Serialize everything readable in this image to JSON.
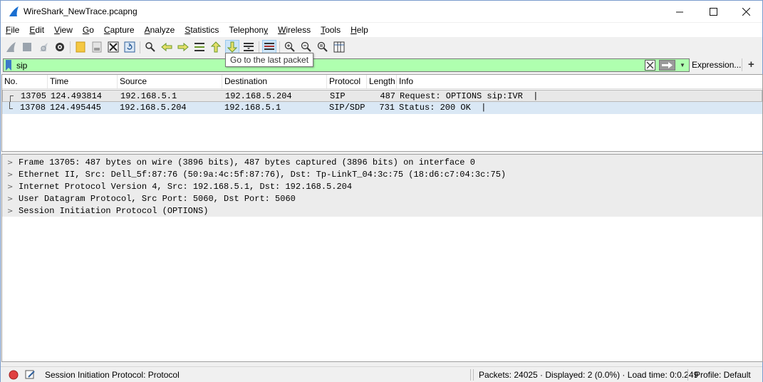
{
  "window": {
    "title": "WireShark_NewTrace.pcapng"
  },
  "menu": [
    "File",
    "Edit",
    "View",
    "Go",
    "Capture",
    "Analyze",
    "Statistics",
    "Telephony",
    "Wireless",
    "Tools",
    "Help"
  ],
  "menu_underline": [
    "F",
    "E",
    "V",
    "G",
    "C",
    "A",
    "S",
    "y",
    "W",
    "T",
    "H"
  ],
  "tooltip": "Go to the last packet",
  "filter": {
    "value": "sip",
    "expression_label": "Expression...",
    "plus_label": "+"
  },
  "packet_list": {
    "columns": [
      "No.",
      "Time",
      "Source",
      "Destination",
      "Protocol",
      "Length",
      "Info"
    ],
    "rows": [
      {
        "no": "13705",
        "time": "124.493814",
        "source": "192.168.5.1",
        "destination": "192.168.5.204",
        "protocol": "SIP",
        "length": "487",
        "info": "Request: OPTIONS sip:IVR  |"
      },
      {
        "no": "13708",
        "time": "124.495445",
        "source": "192.168.5.204",
        "destination": "192.168.5.1",
        "protocol": "SIP/SDP",
        "length": "731",
        "info": "Status: 200 OK  |"
      }
    ]
  },
  "details": [
    "Frame 13705: 487 bytes on wire (3896 bits), 487 bytes captured (3896 bits) on interface 0",
    "Ethernet II, Src: Dell_5f:87:76 (50:9a:4c:5f:87:76), Dst: Tp-LinkT_04:3c:75 (18:d6:c7:04:3c:75)",
    "Internet Protocol Version 4, Src: 192.168.5.1, Dst: 192.168.5.204",
    "User Datagram Protocol, Src Port: 5060, Dst Port: 5060",
    "Session Initiation Protocol (OPTIONS)"
  ],
  "status": {
    "left_text": "Session Initiation Protocol: Protocol",
    "packets_text": "Packets: 24025 · Displayed: 2 (0.0%) · Load time: 0:0.249",
    "profile_text": "Profile: Default"
  },
  "colors": {
    "filter_valid": "#afffaf",
    "row_alt": "#dae8f5",
    "accent": "#3c78c8",
    "record_red": "#e04040"
  }
}
